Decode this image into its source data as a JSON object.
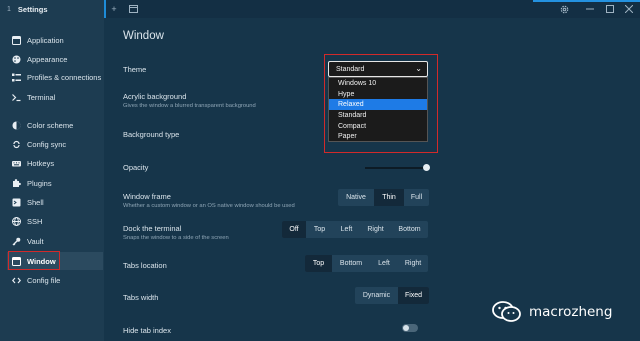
{
  "app": {
    "title": "Settings",
    "tab_number": "1"
  },
  "sidebar": {
    "items": [
      {
        "label": "Application",
        "icon": "window-icon"
      },
      {
        "label": "Appearance",
        "icon": "palette-icon"
      },
      {
        "label": "Profiles & connections",
        "icon": "list-icon"
      },
      {
        "label": "Terminal",
        "icon": "terminal-icon"
      },
      {
        "label": "Color scheme",
        "icon": "color-icon"
      },
      {
        "label": "Config sync",
        "icon": "sync-icon"
      },
      {
        "label": "Hotkeys",
        "icon": "keyboard-icon"
      },
      {
        "label": "Plugins",
        "icon": "puzzle-icon"
      },
      {
        "label": "Shell",
        "icon": "shell-icon"
      },
      {
        "label": "SSH",
        "icon": "globe-icon"
      },
      {
        "label": "Vault",
        "icon": "key-icon"
      },
      {
        "label": "Window",
        "icon": "window-icon",
        "active": true
      },
      {
        "label": "Config file",
        "icon": "code-icon"
      }
    ]
  },
  "main": {
    "title": "Window",
    "theme": {
      "label": "Theme",
      "selected": "Standard",
      "options": [
        "Windows 10",
        "Hype",
        "Relaxed",
        "Standard",
        "Compact",
        "Paper"
      ],
      "highlighted": "Relaxed"
    },
    "acrylic": {
      "label": "Acrylic background",
      "desc": "Gives the window a blurred transparent background"
    },
    "background_type": {
      "label": "Background type"
    },
    "opacity": {
      "label": "Opacity",
      "value": 1.0
    },
    "window_frame": {
      "label": "Window frame",
      "desc": "Whether a custom window or an OS native window should be used",
      "options": [
        "Native",
        "Thin",
        "Full"
      ],
      "selected": "Thin"
    },
    "dock": {
      "label": "Dock the terminal",
      "desc": "Snaps the window to a side of the screen",
      "options": [
        "Off",
        "Top",
        "Left",
        "Right",
        "Bottom"
      ],
      "selected": "Off"
    },
    "tabs_location": {
      "label": "Tabs location",
      "options": [
        "Top",
        "Bottom",
        "Left",
        "Right"
      ],
      "selected": "Top"
    },
    "tabs_width": {
      "label": "Tabs width",
      "options": [
        "Dynamic",
        "Fixed"
      ],
      "selected": "Fixed"
    },
    "hide_tab_index": {
      "label": "Hide tab index",
      "on": false
    }
  },
  "watermark": {
    "text": "macrozheng"
  },
  "colors": {
    "accent": "#2492e0",
    "highlight_border": "#d12a2a",
    "selected_option": "#1e7be6"
  }
}
